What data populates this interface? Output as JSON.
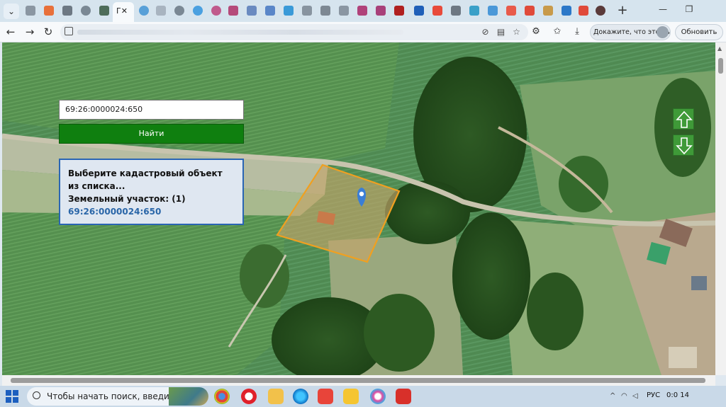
{
  "browser": {
    "new_tab_glyph": "+",
    "active_tab_glyph": "Г✕",
    "window_buttons": [
      "—",
      "❐"
    ],
    "sign_in_label": "Докажите, что это вы",
    "update_label": "Обновить"
  },
  "map": {
    "search_value": "69:26:0000024:650",
    "find_button_label": "Найти",
    "result": {
      "prompt": "Выберите кадастровый объект из списка...",
      "category": "Земельный участок: (1)",
      "item": "69:26:0000024:650"
    },
    "up_icon": "arrow-up-icon",
    "down_icon": "arrow-down-icon",
    "parcel_outline_color": "#f0a020",
    "marker_color": "#3a7ed6"
  },
  "taskbar": {
    "search_placeholder": "Чтобы начать поиск, введите",
    "language": "РУС",
    "clock": "0:0 14"
  },
  "colors": {
    "find_button": "#0f7f0f",
    "result_border": "#2a65b4",
    "result_link": "#2a66a8"
  }
}
